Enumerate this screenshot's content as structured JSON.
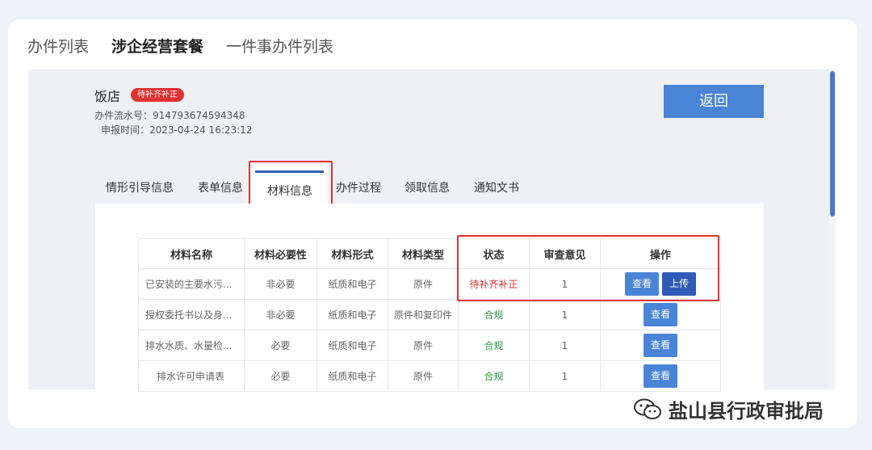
{
  "top_tabs": [
    "办件列表",
    "涉企经营套餐",
    "一件事办件列表"
  ],
  "record": {
    "name": "饭店",
    "status_badge": "待补齐补正",
    "serial_label": "办件流水号：914793674594348",
    "time_label": "申报时间：2023-04-24 16:23:12"
  },
  "back_button": "返回",
  "sub_tabs": [
    "情形引导信息",
    "表单信息",
    "材料信息",
    "办件过程",
    "领取信息",
    "通知文书"
  ],
  "table": {
    "headers": [
      "材料名称",
      "材料必要性",
      "材料形式",
      "材料类型",
      "状态",
      "审查意见",
      "操作"
    ],
    "rows": [
      {
        "name": "已安装的主要水污...",
        "necessity": "非必要",
        "form": "纸质和电子",
        "type": "原件",
        "status": "待补齐补正",
        "opinion": "1",
        "actions": [
          "查看",
          "上传"
        ]
      },
      {
        "name": "授权委托书以及身...",
        "necessity": "非必要",
        "form": "纸质和电子",
        "type": "原件和复印件",
        "status": "合规",
        "opinion": "1",
        "actions": [
          "查看"
        ]
      },
      {
        "name": "排水水质、水量检...",
        "necessity": "必要",
        "form": "纸质和电子",
        "type": "原件",
        "status": "合规",
        "opinion": "1",
        "actions": [
          "查看"
        ]
      },
      {
        "name": "排水许可申请表",
        "necessity": "必要",
        "form": "纸质和电子",
        "type": "原件",
        "status": "合规",
        "opinion": "1",
        "actions": [
          "查看"
        ]
      }
    ]
  },
  "watermark": "盐山县行政审批局",
  "colors": {
    "accent": "#4a84d6",
    "danger": "#e03131",
    "success": "#2e9b47"
  }
}
